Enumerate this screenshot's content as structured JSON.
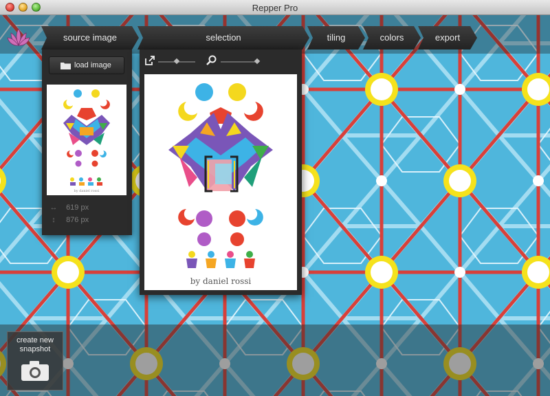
{
  "window": {
    "title": "Repper Pro"
  },
  "tabs": {
    "source": "source image",
    "selection": "selection",
    "tiling": "tiling",
    "colors": "colors",
    "export": "export"
  },
  "source_panel": {
    "load_label": "load image",
    "width": "619 px",
    "height": "876 px",
    "thumb_caption": "by daniel rossi"
  },
  "selection_panel": {
    "credit": "by daniel rossi"
  },
  "bottom": {
    "snapshot_label_line1": "create new",
    "snapshot_label_line2": "snapshot"
  },
  "colors": {
    "pattern_bg": "#4fb6dc",
    "pattern_line": "#d8403a",
    "node_fill": "#ffffff",
    "node_ring": "#f5e21c",
    "panel_bg": "#2b2b2b"
  },
  "icons": [
    "lotus-logo-icon",
    "folder-icon",
    "expand-icon",
    "zoom-icon",
    "camera-icon",
    "width-arrow-icon",
    "height-arrow-icon"
  ]
}
